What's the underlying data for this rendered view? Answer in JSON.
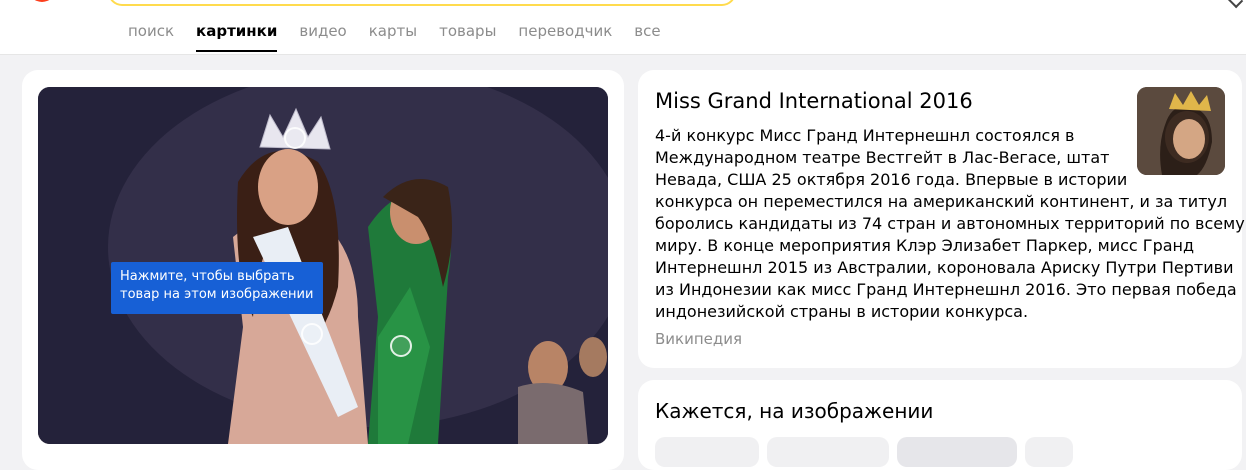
{
  "nav": {
    "tabs": [
      {
        "label": "поиск",
        "active": false
      },
      {
        "label": "картинки",
        "active": true
      },
      {
        "label": "видео",
        "active": false
      },
      {
        "label": "карты",
        "active": false
      },
      {
        "label": "товары",
        "active": false
      },
      {
        "label": "переводчик",
        "active": false
      },
      {
        "label": "все",
        "active": false
      }
    ]
  },
  "image_panel": {
    "tooltip_line1": "Нажмите, чтобы выбрать",
    "tooltip_line2": "товар на этом изображении",
    "hotspot_count": 3
  },
  "info_card": {
    "title": "Miss Grand International 2016",
    "text_lines": [
      "4-й конкурс Мисс Гранд Интернешнл состоялся в",
      "Международном театре Вестгейт в Лас-Вегасе, штат",
      "Невада, США 25 октября 2016 года. Впервые в истории",
      "конкурса он переместился на американский континент, и за титул",
      "боролись кандидаты из 74 стран и автономных территорий по всему",
      "миру. В конце мероприятия Клэр Элизабет Паркер, мисс Гранд",
      "Интернешнл 2015 из Австралии, короновала Ариску Путри Пертиви",
      "из Индонезии как мисс Гранд Интернешнл 2016. Это первая победа",
      "индонезийской страны в истории конкурса."
    ],
    "source": "Википедия"
  },
  "seems_card": {
    "title": "Кажется, на изображении"
  },
  "colors": {
    "accent_blue": "#1760d6",
    "brand_red": "#fc3f1d",
    "search_border": "#ffdb4d",
    "muted_text": "#8c8c8c"
  }
}
